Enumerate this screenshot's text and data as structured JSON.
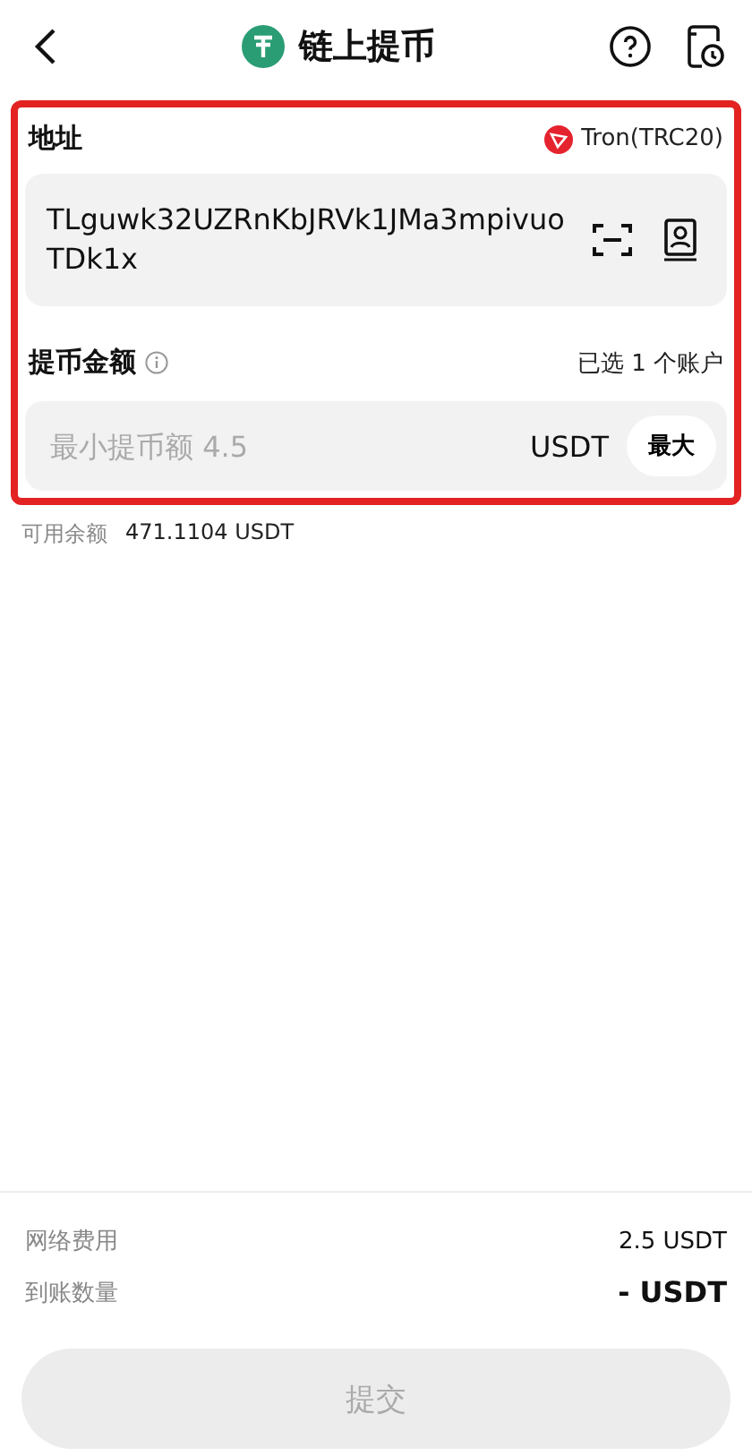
{
  "header": {
    "title": "链上提币"
  },
  "address": {
    "label": "地址",
    "network": "Tron(TRC20)",
    "value": "TLguwk32UZRnKbJRVk1JMa3mpivuoTDk1x"
  },
  "amount": {
    "label": "提币金额",
    "accounts": "已选 1 个账户",
    "placeholder": "最小提币额 4.5",
    "unit": "USDT",
    "max_button": "最大"
  },
  "available": {
    "label": "可用余额",
    "value": "471.1104 USDT"
  },
  "summary": [
    {
      "label": "网络费用",
      "value": "2.5 USDT",
      "emphasis": false
    },
    {
      "label": "到账数量",
      "value": "- USDT",
      "emphasis": true
    }
  ],
  "submit": {
    "label": "提交",
    "disabled": true
  }
}
